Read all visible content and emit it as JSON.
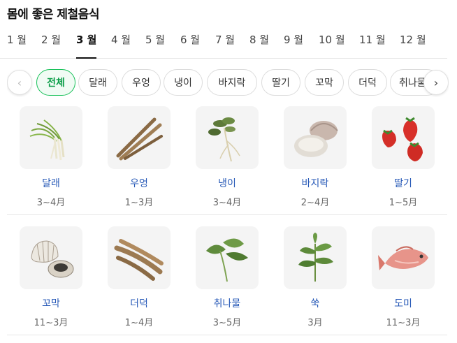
{
  "page": {
    "title": "몸에 좋은 제철음식"
  },
  "months": [
    {
      "label": "1 월"
    },
    {
      "label": "2 월"
    },
    {
      "label": "3 월"
    },
    {
      "label": "4 월"
    },
    {
      "label": "5 월"
    },
    {
      "label": "6 월"
    },
    {
      "label": "7 월"
    },
    {
      "label": "8 월"
    },
    {
      "label": "9 월"
    },
    {
      "label": "10 월"
    },
    {
      "label": "11 월"
    },
    {
      "label": "12 월"
    }
  ],
  "selected_month": "3 월",
  "chips": [
    {
      "label": "전체"
    },
    {
      "label": "달래"
    },
    {
      "label": "우엉"
    },
    {
      "label": "냉이"
    },
    {
      "label": "바지락"
    },
    {
      "label": "딸기"
    },
    {
      "label": "꼬막"
    },
    {
      "label": "더덕"
    },
    {
      "label": "취나물"
    }
  ],
  "selected_chip": "전체",
  "foods": [
    {
      "name": "달래",
      "period": "3~4月",
      "icon": "dallae-icon"
    },
    {
      "name": "우엉",
      "period": "1~3月",
      "icon": "burdock-icon"
    },
    {
      "name": "냉이",
      "period": "3~4月",
      "icon": "shepherds-purse-icon"
    },
    {
      "name": "바지락",
      "period": "2~4月",
      "icon": "clam-icon"
    },
    {
      "name": "딸기",
      "period": "1~5月",
      "icon": "strawberry-icon"
    },
    {
      "name": "꼬막",
      "period": "11~3月",
      "icon": "cockle-icon"
    },
    {
      "name": "더덕",
      "period": "1~4月",
      "icon": "deodeok-root-icon"
    },
    {
      "name": "취나물",
      "period": "3~5月",
      "icon": "chwinamul-leaf-icon"
    },
    {
      "name": "쑥",
      "period": "3月",
      "icon": "mugwort-icon"
    },
    {
      "name": "도미",
      "period": "11~3月",
      "icon": "sea-bream-icon"
    }
  ],
  "colors": {
    "accent": "#19c15a",
    "link": "#2759b7"
  }
}
